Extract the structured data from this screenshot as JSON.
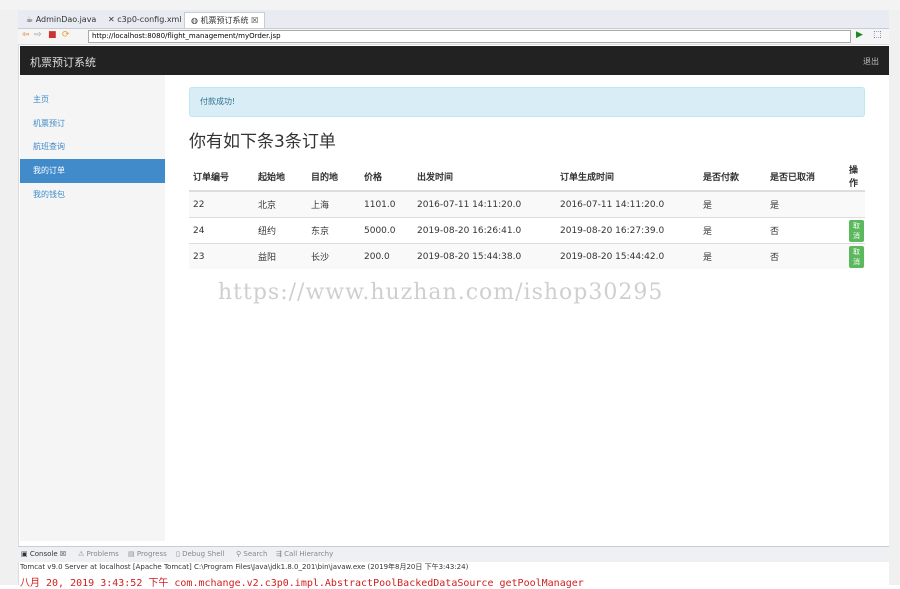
{
  "ide": {
    "editor_tabs": [
      {
        "label": "AdminDao.java",
        "active": false
      },
      {
        "label": "c3p0-config.xml",
        "active": false
      },
      {
        "label": "机票预订系统 ☒",
        "active": true
      }
    ],
    "url": "http://localhost:8080/flight_management/myOrder.jsp",
    "console_tabs": [
      {
        "label": "Console ☒",
        "active": true
      },
      {
        "label": "Problems",
        "active": false
      },
      {
        "label": "Progress",
        "active": false
      },
      {
        "label": "Debug Shell",
        "active": false
      },
      {
        "label": "Search",
        "active": false
      },
      {
        "label": "Call Hierarchy",
        "active": false
      }
    ],
    "console_status": "Tomcat v9.0 Server at localhost [Apache Tomcat] C:\\Program Files\\Java\\jdk1.8.0_201\\bin\\javaw.exe (2019年8月20日 下午3:43:24)",
    "console_log": "八月 20, 2019 3:43:52 下午 com.mchange.v2.c3p0.impl.AbstractPoolBackedDataSource getPoolManager"
  },
  "app": {
    "brand": "机票预订系统",
    "logout": "退出",
    "sidebar": [
      {
        "label": "主页",
        "active": false
      },
      {
        "label": "机票预订",
        "active": false
      },
      {
        "label": "航班查询",
        "active": false
      },
      {
        "label": "我的订单",
        "active": true
      },
      {
        "label": "我的钱包",
        "active": false
      }
    ],
    "alert": "付款成功!",
    "heading": "你有如下条3条订单",
    "table": {
      "headers": [
        "订单编号",
        "起始地",
        "目的地",
        "价格",
        "出发时间",
        "订单生成时间",
        "是否付款",
        "是否已取消",
        "操作"
      ],
      "rows": [
        [
          "22",
          "北京",
          "上海",
          "1101.0",
          "2016-07-11 14:11:20.0",
          "2016-07-11 14:11:20.0",
          "是",
          "是",
          ""
        ],
        [
          "24",
          "纽约",
          "东京",
          "5000.0",
          "2019-08-20 16:26:41.0",
          "2019-08-20 16:27:39.0",
          "是",
          "否",
          "取消"
        ],
        [
          "23",
          "益阳",
          "长沙",
          "200.0",
          "2019-08-20 15:44:38.0",
          "2019-08-20 15:44:42.0",
          "是",
          "否",
          "取消"
        ]
      ]
    }
  },
  "watermark": "https://www.huzhan.com/ishop30295",
  "colors": {
    "navbar": "#222222",
    "sidebar_active": "#428bca",
    "alert_bg": "#d9edf7",
    "cancel_btn": "#5cb85c",
    "console_log": "#d02020"
  }
}
